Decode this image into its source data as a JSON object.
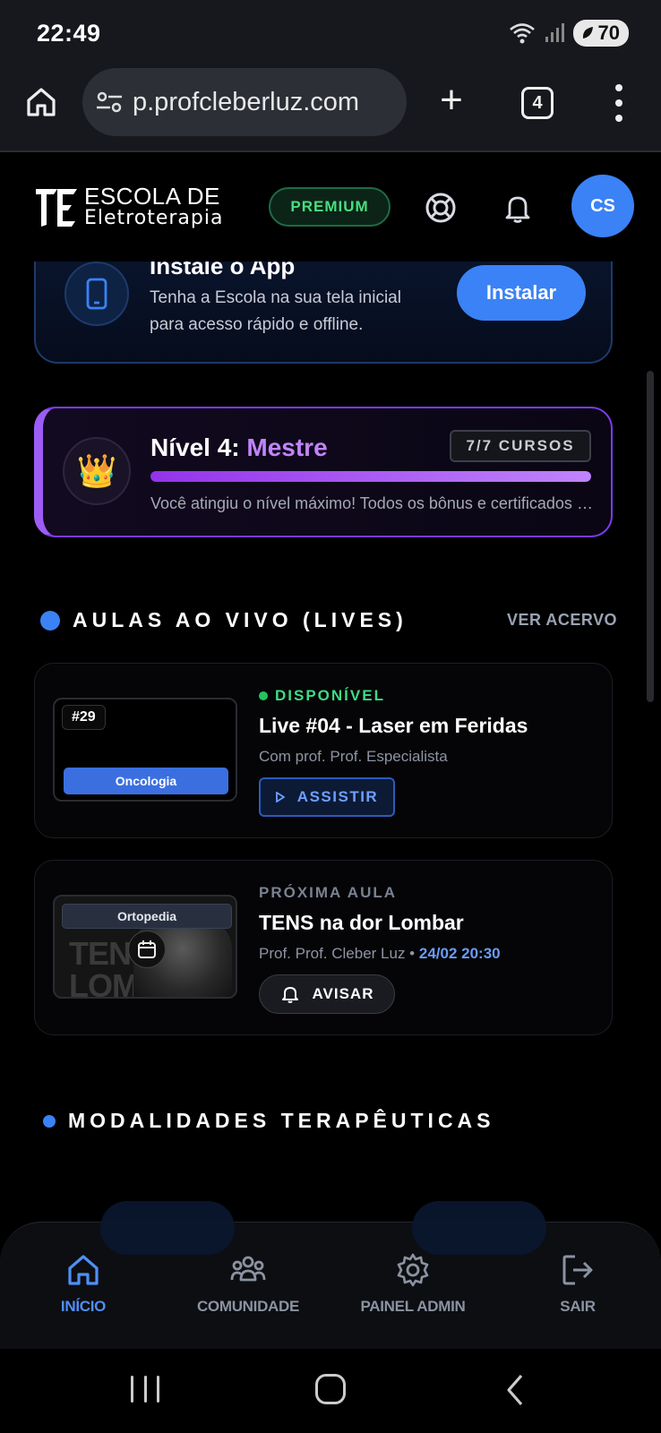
{
  "status_bar": {
    "time": "22:49",
    "battery": "70",
    "icons": [
      "wifi-icon",
      "signal-icon",
      "battery-icon"
    ]
  },
  "browser": {
    "url": "p.profcleberluz.com",
    "tab_count": "4",
    "icons": [
      "home-icon",
      "site-settings-icon",
      "plus-icon",
      "tabs-icon",
      "more-vert-icon"
    ]
  },
  "header": {
    "logo_line1": "ESCOLA DE",
    "logo_line2": "Eletroterapia",
    "premium_label": "PREMIUM",
    "avatar_initials": "CS"
  },
  "install_card": {
    "title": "Instale o App",
    "description": "Tenha a Escola na sua tela inicial para acesso rápido e offline.",
    "button": "Instalar"
  },
  "level_card": {
    "title_prefix": "Nível 4: ",
    "title_accent": "Mestre",
    "courses_badge": "7/7 CURSOS",
    "progress": 1.0,
    "description": "Você atingiu o nível máximo! Todos os bônus e certificados foram desbloqueados."
  },
  "lives_section": {
    "title": "AULAS AO VIVO (LIVES)",
    "link": "VER ACERVO",
    "items": [
      {
        "thumb_number": "#29",
        "thumb_tag": "Oncologia",
        "status": "DISPONÍVEL",
        "title": "Live #04 - Laser em Feridas",
        "subtitle": "Com prof. Prof. Especialista",
        "button": "ASSISTIR"
      },
      {
        "thumb_tag": "Ortopedia",
        "thumb_bg_text_1": "TENS NA",
        "thumb_bg_text_2": "LOMBA",
        "status": "PRÓXIMA AULA",
        "title": "TENS na dor Lombar",
        "subtitle": "Prof. Prof. Cleber Luz • ",
        "when": "24/02 20:30",
        "button": "AVISAR"
      }
    ]
  },
  "modalities_section": {
    "title": "MODALIDADES TERAPÊUTICAS"
  },
  "bottom_nav": {
    "items": [
      {
        "label": "INÍCIO",
        "icon": "home-icon",
        "active": true
      },
      {
        "label": "COMUNIDADE",
        "icon": "users-icon",
        "active": false
      },
      {
        "label": "PAINEL ADMIN",
        "icon": "gear-icon",
        "active": false
      },
      {
        "label": "SAIR",
        "icon": "logout-icon",
        "active": false
      }
    ]
  },
  "colors": {
    "accent_blue": "#3b82f6",
    "accent_purple": "#c084fc",
    "premium_green": "#4ade80",
    "status_green": "#22c55e"
  }
}
